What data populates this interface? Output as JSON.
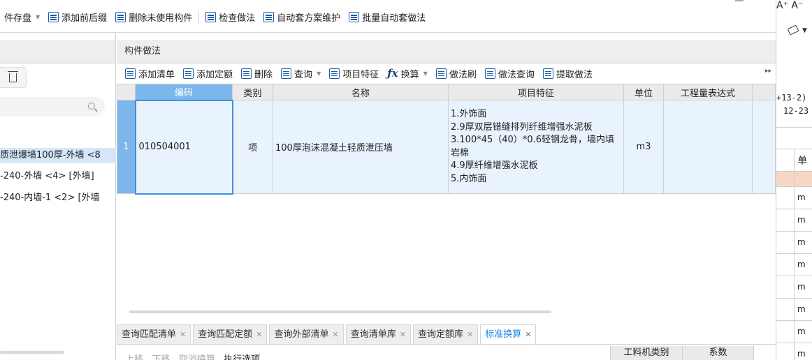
{
  "toolbar": {
    "items": [
      {
        "label": "件存盘",
        "icon": "save-icon",
        "dropdown": true
      },
      {
        "label": "添加前后缀",
        "icon": "prefix-icon"
      },
      {
        "label": "删除未使用构件",
        "icon": "delete-unused-icon"
      },
      {
        "label": "检查做法",
        "icon": "check-icon"
      },
      {
        "label": "自动套方案维护",
        "icon": "auto-plan-icon"
      },
      {
        "label": "批量自动套做法",
        "icon": "batch-icon"
      }
    ]
  },
  "left_panel": {
    "tree_items": [
      "质泄爆墙100厚-外墙 <8",
      "-240-外墙 <4> [外墙]",
      "-240-内墙-1 <2> [外墙"
    ]
  },
  "main": {
    "title": "构件做法",
    "toolbar": {
      "add_list": "添加清单",
      "add_quota": "添加定额",
      "delete": "删除",
      "query": "查询",
      "item_feature": "项目特征",
      "convert": "换算",
      "method_brush": "做法刷",
      "method_query": "做法查询",
      "extract_method": "提取做法",
      "collapse": "▸▸"
    },
    "table": {
      "headers": [
        "",
        "编码",
        "类别",
        "名称",
        "项目特征",
        "单位",
        "工程量表达式",
        ""
      ],
      "rows": [
        {
          "num": "1",
          "code": "010504001",
          "category": "项",
          "name": "100厚泡沫混凝土轻质泄压墙",
          "features": "1.外饰面\n2.9厚双层错缝排列纤维增强水泥板\n3.100*45（40）*0.6轻钢龙骨，墙内填岩棉\n4.9厚纤维增强水泥板\n5.内饰面",
          "unit": "m3",
          "expression": ""
        }
      ]
    },
    "tabs": [
      {
        "label": "查询匹配清单",
        "active": false
      },
      {
        "label": "查询匹配定额",
        "active": false
      },
      {
        "label": "查询外部清单",
        "active": false
      },
      {
        "label": "查询清单库",
        "active": false
      },
      {
        "label": "查询定额库",
        "active": false
      },
      {
        "label": "标准换算",
        "active": true
      }
    ],
    "bottom": {
      "actions": [
        "上移",
        "下移",
        "取消换算",
        "执行选项"
      ],
      "col_headers": [
        "工料机类别",
        "系数"
      ]
    }
  },
  "right_panel": {
    "font_controls": "A⁺  A⁻",
    "code_line1": "+13-2)",
    "code_line2": "12-23",
    "header_char": "单",
    "row_char": "m",
    "colors": {
      "highlight_row": "#f7d6c4"
    }
  }
}
